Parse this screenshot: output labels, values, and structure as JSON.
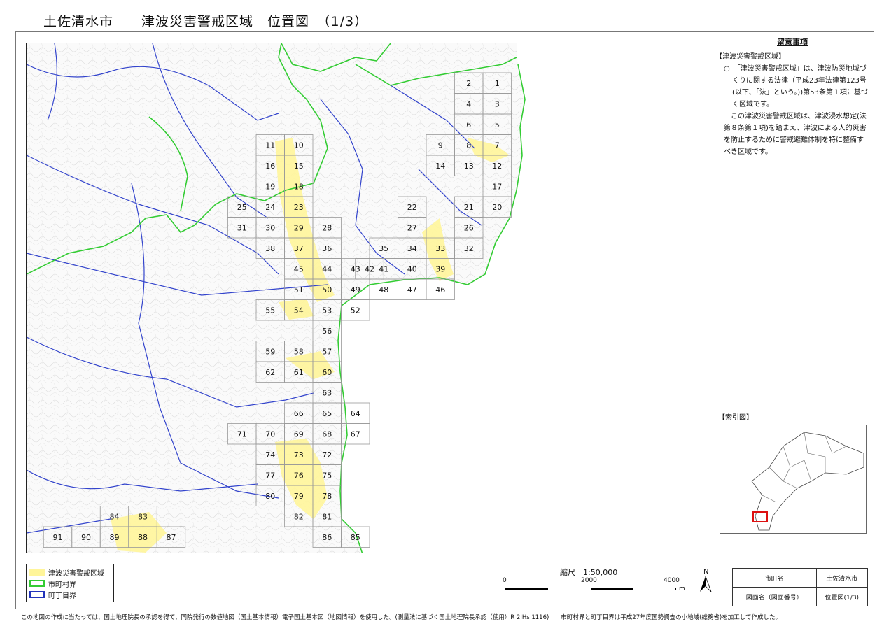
{
  "title": "土佐清水市　　津波災害警戒区域　位置図　（1/3）",
  "notes": {
    "heading": "留意事項",
    "section": "【津波災害警戒区域】",
    "para1": "○　「津波災害警戒区域」は、津波防災地域づくりに関する法律（平成23年法律第123号(以下、「法」という。))第53条第１項に基づく区域です。",
    "para2": "この津波災害警戒区域は、津波浸水想定(法第８条第１項)を踏まえ、津波による人的災害を防止するために警戒避難体制を特に整備すべき区域です。"
  },
  "index_label": "【索引図】",
  "legend": [
    {
      "label": "津波災害警戒区域",
      "color": "#fff59a"
    },
    {
      "label": "市町村界",
      "color": "#33cc33"
    },
    {
      "label": "町丁目界",
      "color": "#2233bb"
    }
  ],
  "scale": {
    "title": "縮尺　1:50,000",
    "ticks": [
      "0",
      "2000",
      "4000"
    ],
    "unit": "m"
  },
  "north": "N",
  "info": {
    "row1_label": "市町名",
    "row1_value": "土佐清水市",
    "row2_label": "図面名（図面番号）",
    "row2_value": "位置図(1/3)"
  },
  "footer": "この地図の作成に当たっては、国土地理院長の承認を得て、同院発行の数値地図（国土基本情報）電子国土基本図（地図情報）を使用した。(測量法に基づく国土地理院長承認（使用）R 2JHs 1116)　　市町村界と町丁目界は平成27年度国勢調査の小地域(総務省)を加工して作成した。",
  "tiles": [
    {
      "n": "1",
      "c": 16,
      "r": 0
    },
    {
      "n": "2",
      "c": 15,
      "r": 0
    },
    {
      "n": "3",
      "c": 16,
      "r": 1
    },
    {
      "n": "4",
      "c": 15,
      "r": 1
    },
    {
      "n": "5",
      "c": 16,
      "r": 2
    },
    {
      "n": "6",
      "c": 15,
      "r": 2
    },
    {
      "n": "7",
      "c": 16,
      "r": 3
    },
    {
      "n": "8",
      "c": 15,
      "r": 3
    },
    {
      "n": "9",
      "c": 14,
      "r": 3
    },
    {
      "n": "10",
      "c": 9,
      "r": 3
    },
    {
      "n": "11",
      "c": 8,
      "r": 3
    },
    {
      "n": "12",
      "c": 16,
      "r": 4
    },
    {
      "n": "13",
      "c": 15,
      "r": 4
    },
    {
      "n": "14",
      "c": 14,
      "r": 4
    },
    {
      "n": "15",
      "c": 9,
      "r": 4
    },
    {
      "n": "16",
      "c": 8,
      "r": 4
    },
    {
      "n": "17",
      "c": 16,
      "r": 5
    },
    {
      "n": "18",
      "c": 9,
      "r": 5
    },
    {
      "n": "19",
      "c": 8,
      "r": 5
    },
    {
      "n": "20",
      "c": 16,
      "r": 6
    },
    {
      "n": "21",
      "c": 15,
      "r": 6
    },
    {
      "n": "22",
      "c": 13,
      "r": 6
    },
    {
      "n": "23",
      "c": 9,
      "r": 6
    },
    {
      "n": "24",
      "c": 8,
      "r": 6
    },
    {
      "n": "25",
      "c": 7,
      "r": 6
    },
    {
      "n": "26",
      "c": 15,
      "r": 7
    },
    {
      "n": "27",
      "c": 13,
      "r": 7
    },
    {
      "n": "28",
      "c": 10,
      "r": 7
    },
    {
      "n": "29",
      "c": 9,
      "r": 7
    },
    {
      "n": "30",
      "c": 8,
      "r": 7
    },
    {
      "n": "31",
      "c": 7,
      "r": 7
    },
    {
      "n": "32",
      "c": 15,
      "r": 8
    },
    {
      "n": "33",
      "c": 14,
      "r": 8
    },
    {
      "n": "34",
      "c": 13,
      "r": 8
    },
    {
      "n": "35",
      "c": 12,
      "r": 8
    },
    {
      "n": "36",
      "c": 10,
      "r": 8
    },
    {
      "n": "37",
      "c": 9,
      "r": 8
    },
    {
      "n": "38",
      "c": 8,
      "r": 8
    },
    {
      "n": "39",
      "c": 14,
      "r": 9
    },
    {
      "n": "40",
      "c": 13,
      "r": 9
    },
    {
      "n": "41",
      "c": 12,
      "r": 9
    },
    {
      "n": "42",
      "c": 11.5,
      "r": 9
    },
    {
      "n": "43",
      "c": 11,
      "r": 9
    },
    {
      "n": "44",
      "c": 10,
      "r": 9
    },
    {
      "n": "45",
      "c": 9,
      "r": 9
    },
    {
      "n": "46",
      "c": 14,
      "r": 10
    },
    {
      "n": "47",
      "c": 13,
      "r": 10
    },
    {
      "n": "48",
      "c": 12,
      "r": 10
    },
    {
      "n": "49",
      "c": 11,
      "r": 10
    },
    {
      "n": "50",
      "c": 10,
      "r": 10
    },
    {
      "n": "51",
      "c": 9,
      "r": 10
    },
    {
      "n": "52",
      "c": 11,
      "r": 11
    },
    {
      "n": "53",
      "c": 10,
      "r": 11
    },
    {
      "n": "54",
      "c": 9,
      "r": 11
    },
    {
      "n": "55",
      "c": 8,
      "r": 11
    },
    {
      "n": "56",
      "c": 10,
      "r": 12
    },
    {
      "n": "57",
      "c": 10,
      "r": 13
    },
    {
      "n": "58",
      "c": 9,
      "r": 13
    },
    {
      "n": "59",
      "c": 8,
      "r": 13
    },
    {
      "n": "60",
      "c": 10,
      "r": 14
    },
    {
      "n": "61",
      "c": 9,
      "r": 14
    },
    {
      "n": "62",
      "c": 8,
      "r": 14
    },
    {
      "n": "63",
      "c": 10,
      "r": 15
    },
    {
      "n": "64",
      "c": 11,
      "r": 16
    },
    {
      "n": "65",
      "c": 10,
      "r": 16
    },
    {
      "n": "66",
      "c": 9,
      "r": 16
    },
    {
      "n": "67",
      "c": 11,
      "r": 17
    },
    {
      "n": "68",
      "c": 10,
      "r": 17
    },
    {
      "n": "69",
      "c": 9,
      "r": 17
    },
    {
      "n": "70",
      "c": 8,
      "r": 17
    },
    {
      "n": "71",
      "c": 7,
      "r": 17
    },
    {
      "n": "72",
      "c": 10,
      "r": 18
    },
    {
      "n": "73",
      "c": 9,
      "r": 18
    },
    {
      "n": "74",
      "c": 8,
      "r": 18
    },
    {
      "n": "75",
      "c": 10,
      "r": 19
    },
    {
      "n": "76",
      "c": 9,
      "r": 19
    },
    {
      "n": "77",
      "c": 8,
      "r": 19
    },
    {
      "n": "78",
      "c": 10,
      "r": 20
    },
    {
      "n": "79",
      "c": 9,
      "r": 20
    },
    {
      "n": "80",
      "c": 8,
      "r": 20
    },
    {
      "n": "81",
      "c": 10,
      "r": 21
    },
    {
      "n": "82",
      "c": 9,
      "r": 21
    },
    {
      "n": "83",
      "c": 3.5,
      "r": 21
    },
    {
      "n": "84",
      "c": 2.5,
      "r": 21
    },
    {
      "n": "85",
      "c": 11,
      "r": 22
    },
    {
      "n": "86",
      "c": 10,
      "r": 22
    },
    {
      "n": "87",
      "c": 4.5,
      "r": 22
    },
    {
      "n": "88",
      "c": 3.5,
      "r": 22
    },
    {
      "n": "89",
      "c": 2.5,
      "r": 22
    },
    {
      "n": "90",
      "c": 1.5,
      "r": 22
    },
    {
      "n": "91",
      "c": 0.5,
      "r": 22
    }
  ]
}
